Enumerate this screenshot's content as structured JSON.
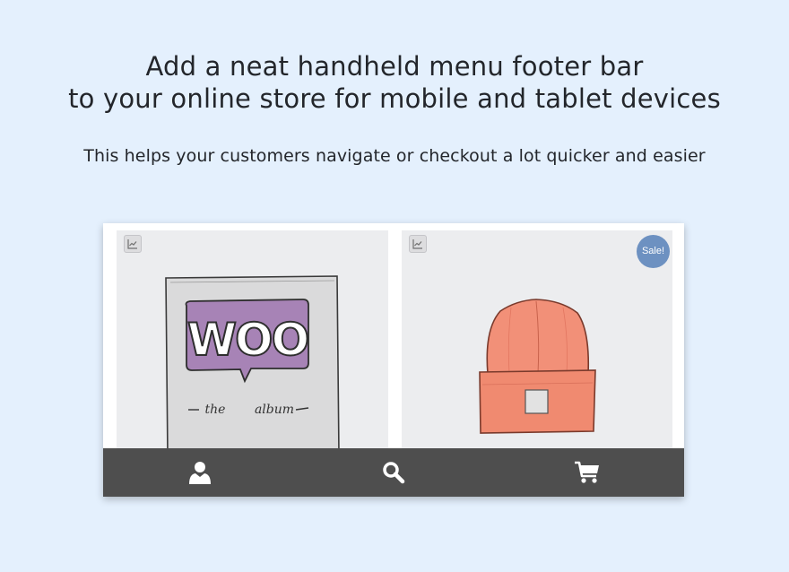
{
  "headline": {
    "line1": "Add a neat handheld menu footer bar",
    "line2": "to your online store for mobile and tablet devices"
  },
  "subheadline": "This helps your customers navigate or checkout a lot quicker and easier",
  "preview": {
    "products": [
      {
        "image": "woo-album-illustration",
        "overlay_icon": "stats-icon",
        "badge": ""
      },
      {
        "image": "orange-beanie-illustration",
        "overlay_icon": "stats-icon",
        "badge": "Sale!"
      }
    ],
    "footer_bar": {
      "items": [
        {
          "icon": "account-icon",
          "color": "#ffffff"
        },
        {
          "icon": "search-icon",
          "color": "#ffffff"
        },
        {
          "icon": "cart-icon",
          "color": "#ffffff"
        }
      ],
      "background": "#4e4e4e"
    }
  },
  "colors": {
    "page_background": "#e4f0fd",
    "text": "#23262b",
    "sale_badge": "#6d91c1",
    "woo_bubble": "#a783b6",
    "beanie": "#f08a70"
  }
}
